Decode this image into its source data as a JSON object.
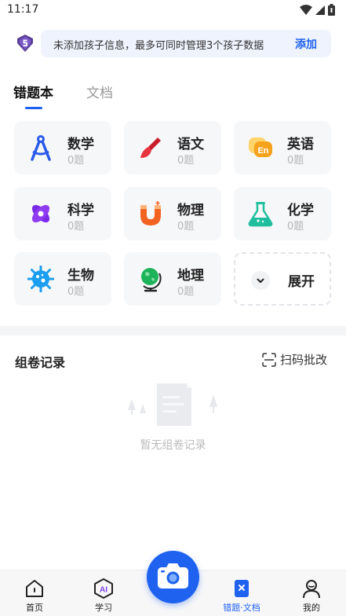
{
  "status_bar": {
    "time": "11:17",
    "icons": [
      "wifi-icon",
      "signal-icon",
      "battery-icon"
    ]
  },
  "banner": {
    "text": "未添加孩子信息，最多可同时管理3个孩子数据",
    "action": "添加"
  },
  "tabs": [
    {
      "label": "错题本",
      "active": true
    },
    {
      "label": "文档",
      "active": false
    }
  ],
  "subjects": [
    {
      "name": "数学",
      "count": "0题",
      "icon": "compass-icon"
    },
    {
      "name": "语文",
      "count": "0题",
      "icon": "brush-icon"
    },
    {
      "name": "英语",
      "count": "0题",
      "icon": "english-icon"
    },
    {
      "name": "科学",
      "count": "0题",
      "icon": "atom-icon"
    },
    {
      "name": "物理",
      "count": "0题",
      "icon": "magnet-icon"
    },
    {
      "name": "化学",
      "count": "0题",
      "icon": "flask-icon"
    },
    {
      "name": "生物",
      "count": "0题",
      "icon": "cell-icon"
    },
    {
      "name": "地理",
      "count": "0题",
      "icon": "globe-icon"
    }
  ],
  "expand": {
    "label": "展开"
  },
  "records": {
    "title": "组卷记录",
    "scan_label": "扫码批改",
    "empty_text": "暂无组卷记录"
  },
  "bottom_nav": [
    {
      "label": "首页",
      "icon": "home-icon",
      "active": false
    },
    {
      "label": "学习",
      "icon": "ai-icon",
      "active": false
    },
    {
      "label": "错题·文档",
      "icon": "notebook-icon",
      "active": true
    },
    {
      "label": "我的",
      "icon": "user-icon",
      "active": false
    }
  ],
  "colors": {
    "accent": "#1e62ef",
    "banner_bg": "#eef3fd",
    "card_bg": "#f6f7f9"
  }
}
